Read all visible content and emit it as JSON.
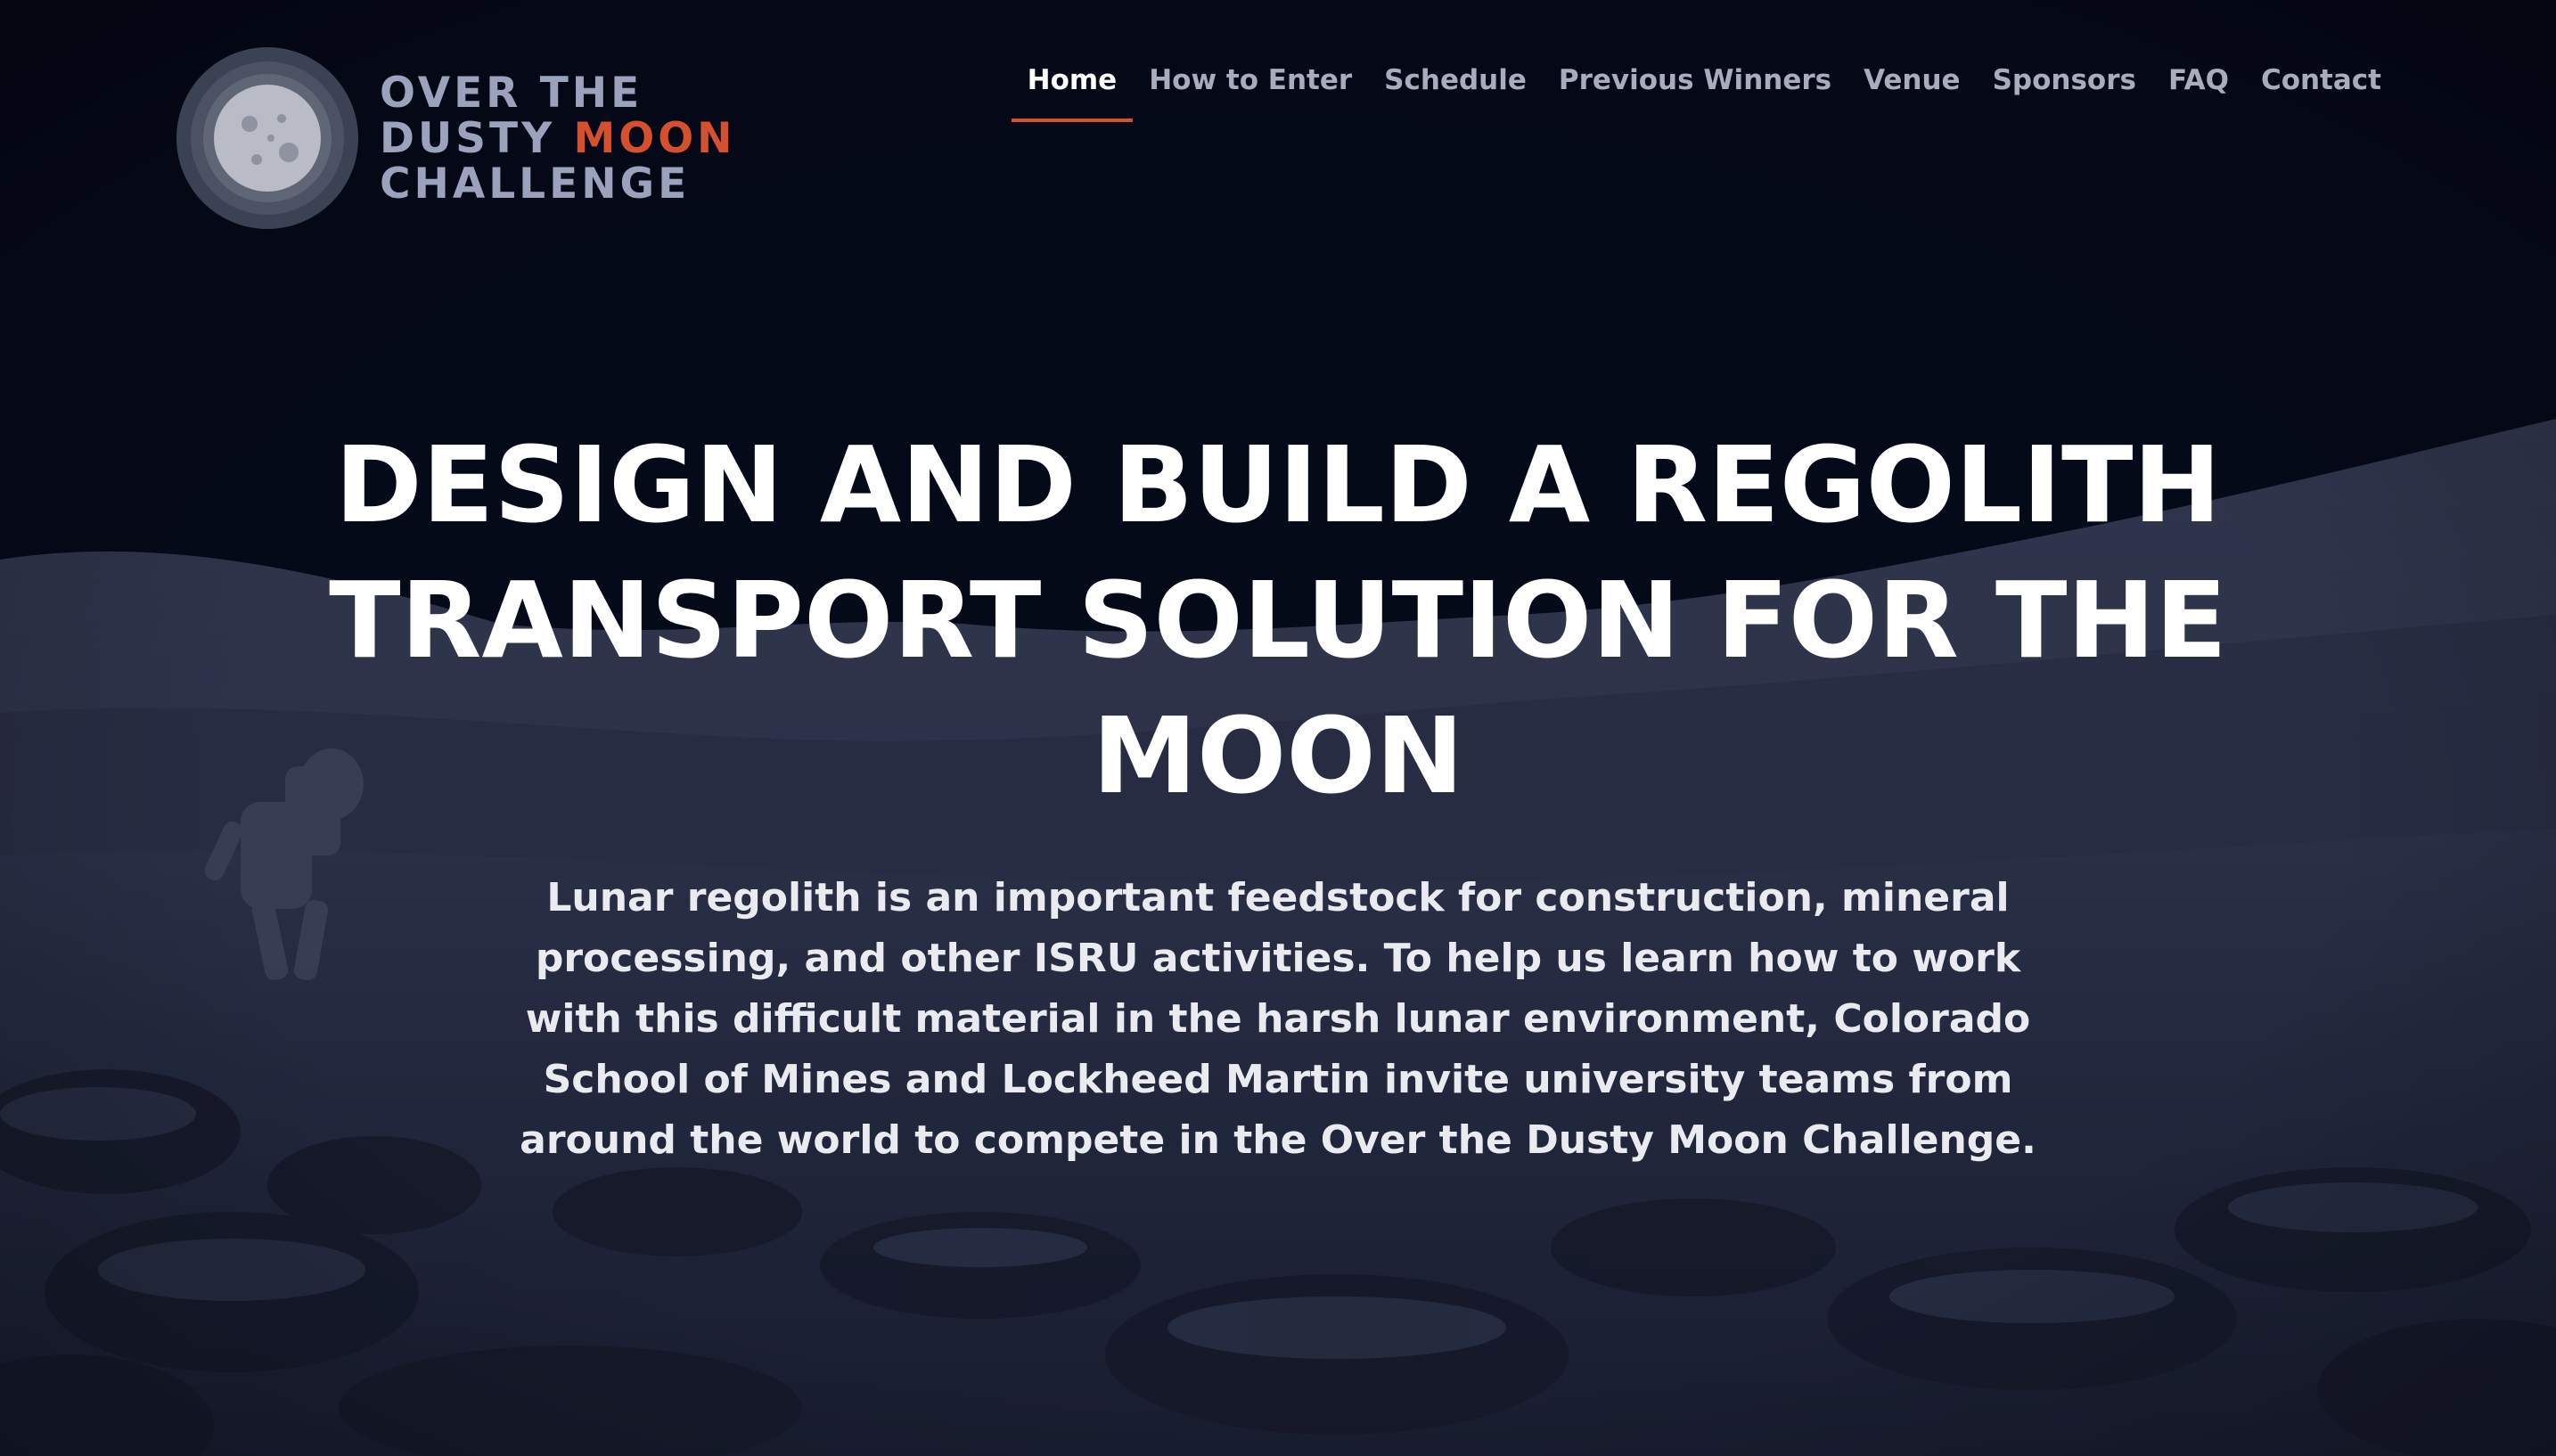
{
  "colors": {
    "background": "#060a19",
    "accent": "#d4502f",
    "nav_text": "#a7adbd",
    "nav_active": "#ffffff",
    "logo_text": "#9aa3bb",
    "terrain": "#2a3047"
  },
  "logo": {
    "icon": "moon-icon",
    "line1": "OVER THE",
    "line2_start": "DUSTY",
    "line2_accent": "MOON",
    "line3": "CHALLENGE"
  },
  "nav": {
    "items": [
      {
        "label": "Home",
        "active": true
      },
      {
        "label": "How to Enter",
        "active": false
      },
      {
        "label": "Schedule",
        "active": false
      },
      {
        "label": "Previous Winners",
        "active": false
      },
      {
        "label": "Venue",
        "active": false
      },
      {
        "label": "Sponsors",
        "active": false
      },
      {
        "label": "FAQ",
        "active": false
      },
      {
        "label": "Contact",
        "active": false
      }
    ]
  },
  "hero": {
    "title": "DESIGN AND BUILD A REGOLITH TRANSPORT SOLUTION FOR THE MOON",
    "description": "Lunar regolith is an important feedstock for construction, mineral processing, and other ISRU activities. To help us learn how to work with this difficult material in the harsh lunar environment, Colorado School of Mines and Lockheed Martin invite university teams from around the world to compete in the Over the Dusty Moon Challenge."
  }
}
